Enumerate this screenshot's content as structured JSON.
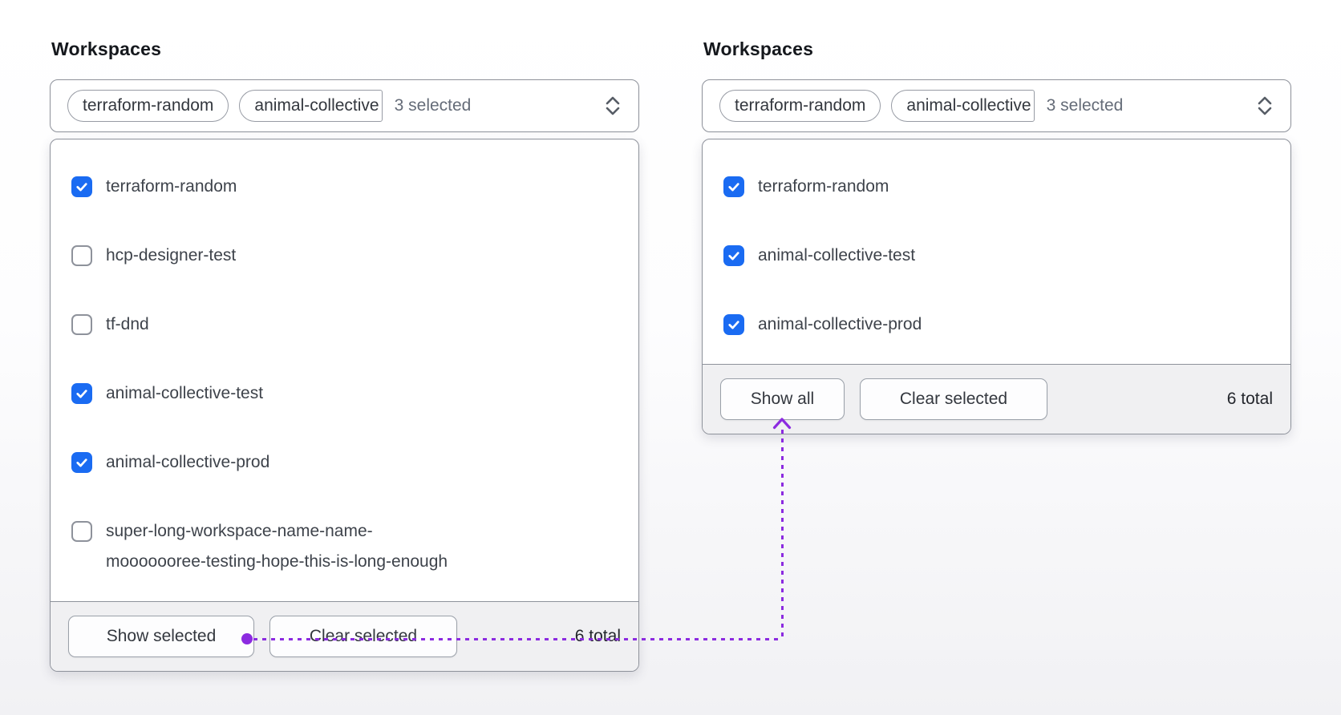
{
  "colors": {
    "checkbox_checked": "#1a6bf2",
    "annotation_purple": "#8c2be0",
    "card_border": "#8e929b",
    "footer_bg": "#f0f0f2"
  },
  "panels": [
    {
      "title": "Workspaces",
      "trigger": {
        "pills": [
          "terraform-random",
          "animal-collective"
        ],
        "summary": "3 selected"
      },
      "items": [
        {
          "label": "terraform-random",
          "checked": true
        },
        {
          "label": "hcp-designer-test",
          "checked": false
        },
        {
          "label": "tf-dnd",
          "checked": false
        },
        {
          "label": "animal-collective-test",
          "checked": true
        },
        {
          "label": "animal-collective-prod",
          "checked": true
        },
        {
          "label": "super-long-workspace-name-name-mooooooree-testing-hope-this-is-long-enough",
          "checked": false
        }
      ],
      "footer": {
        "buttons": [
          "Show selected",
          "Clear selected"
        ],
        "total": "6 total"
      }
    },
    {
      "title": "Workspaces",
      "trigger": {
        "pills": [
          "terraform-random",
          "animal-collective"
        ],
        "summary": "3 selected"
      },
      "items": [
        {
          "label": "terraform-random",
          "checked": true
        },
        {
          "label": "animal-collective-test",
          "checked": true
        },
        {
          "label": "animal-collective-prod",
          "checked": true
        }
      ],
      "footer": {
        "buttons": [
          "Show all",
          "Clear selected"
        ],
        "total": "6 total"
      }
    }
  ]
}
